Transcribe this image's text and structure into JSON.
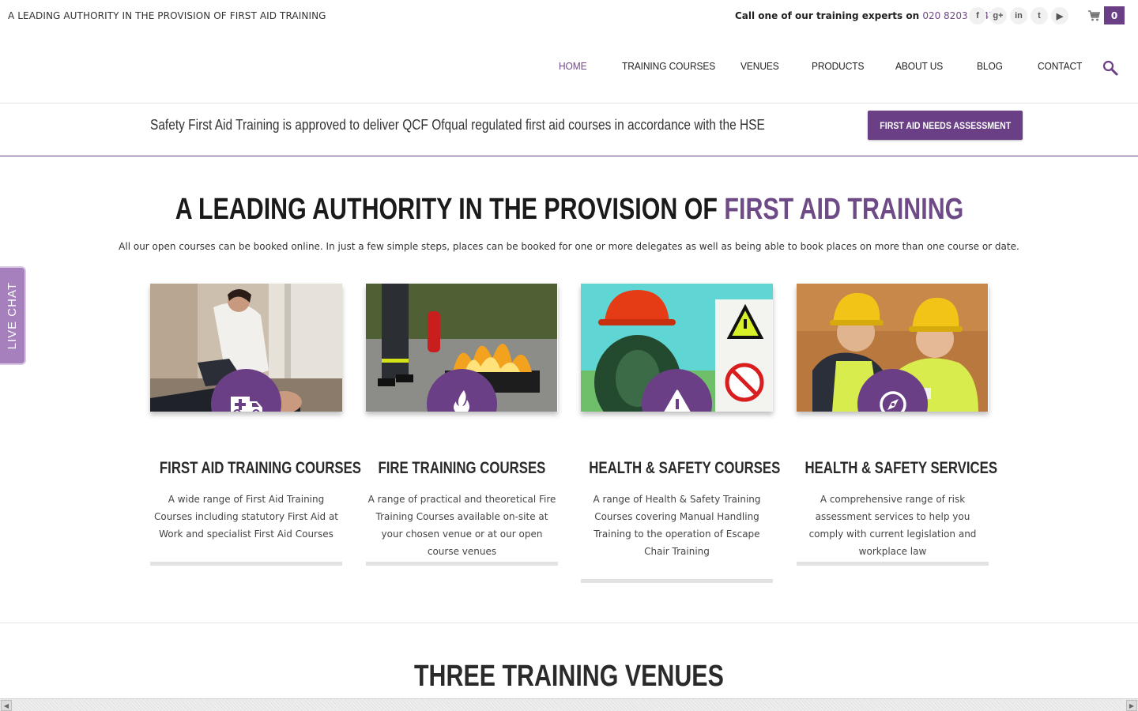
{
  "topbar": {
    "tagline": "A LEADING AUTHORITY IN THE PROVISION OF FIRST AID TRAINING",
    "call_text": "Call one of our training experts on",
    "phone": "020 8203 7447",
    "socials": [
      {
        "icon": "facebook-icon",
        "glyph": "f"
      },
      {
        "icon": "google-plus-icon",
        "glyph": "g+"
      },
      {
        "icon": "linkedin-icon",
        "glyph": "in"
      },
      {
        "icon": "twitter-icon",
        "glyph": "t"
      },
      {
        "icon": "youtube-icon",
        "glyph": "▶"
      }
    ],
    "cart_count": "0"
  },
  "nav": {
    "items": [
      "HOME",
      "TRAINING COURSES",
      "VENUES",
      "PRODUCTS",
      "ABOUT US",
      "BLOG",
      "CONTACT"
    ],
    "active": "HOME"
  },
  "notice": {
    "text": "Safety First Aid Training is approved to deliver QCF Ofqual regulated first aid courses in accordance with the HSE",
    "button": "FIRST AID NEEDS ASSESSMENT"
  },
  "hero": {
    "headline_main": "A LEADING AUTHORITY IN THE PROVISION OF",
    "headline_accent": "FIRST AID TRAINING",
    "intro": "All our open courses can be booked online. In just a few simple steps, places can be booked for one or more delegates as well as being able to book places on more than one course or date."
  },
  "live_chat": "LIVE CHAT",
  "cards": [
    {
      "title": "FIRST AID TRAINING COURSES",
      "icon": "ambulance-icon",
      "desc": "A wide range of First Aid Training Courses including statutory First Aid at Work and specialist First Aid Courses"
    },
    {
      "title": "FIRE TRAINING COURSES",
      "icon": "flame-icon",
      "desc": "A range of practical and theoretical Fire Training Courses available on-site at your chosen venue or at our open course venues"
    },
    {
      "title": "HEALTH & SAFETY COURSES",
      "icon": "warning-icon",
      "desc": "A range of Health & Safety Training Courses covering Manual Handling Training to the operation of Escape Chair Training"
    },
    {
      "title": "HEALTH & SAFETY SERVICES",
      "icon": "compass-icon",
      "desc": "A comprehensive range of risk assessment services to help you comply with current legislation and workplace law"
    }
  ],
  "venues_heading": "THREE TRAINING VENUES",
  "colors": {
    "accent": "#6a3f86",
    "accent_text": "#6e4a86",
    "live_chat": "#a680bd"
  }
}
